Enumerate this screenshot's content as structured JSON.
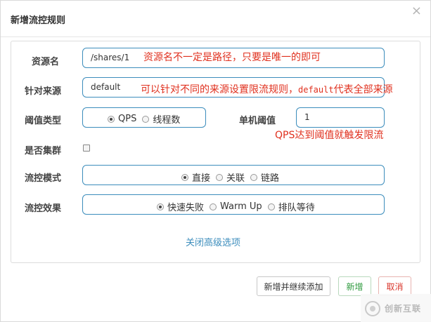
{
  "dialog": {
    "title": "新增流控规则",
    "close_glyph": "×"
  },
  "form": {
    "resource": {
      "label": "资源名",
      "value": "/shares/1",
      "annotation": "资源名不一定是路径，只要是唯一的即可"
    },
    "origin": {
      "label": "针对来源",
      "value": "default",
      "annotation_pre": "可以针对不同的来源设置限流规则，",
      "annotation_code": "default",
      "annotation_post": "代表全部来源"
    },
    "threshold_type": {
      "label": "阈值类型",
      "options": [
        "QPS",
        "线程数"
      ],
      "selected": "QPS"
    },
    "single_threshold": {
      "label": "单机阈值",
      "value": "1",
      "annotation": "QPS达到阈值就触发限流"
    },
    "cluster": {
      "label": "是否集群",
      "checked": false
    },
    "flow_mode": {
      "label": "流控模式",
      "options": [
        "直接",
        "关联",
        "链路"
      ],
      "selected": "直接"
    },
    "flow_effect": {
      "label": "流控效果",
      "options": [
        "快速失败",
        "Warm Up",
        "排队等待"
      ],
      "selected": "快速失败"
    },
    "advanced_link": "关闭高级选项"
  },
  "buttons": {
    "add_continue": "新增并继续添加",
    "add": "新增",
    "cancel": "取消"
  },
  "watermark": {
    "text": "创新互联"
  },
  "colors": {
    "accent": "#3c8dbc",
    "annotation": "#e0301e",
    "success": "#2e9a3e",
    "danger": "#d9362b"
  }
}
